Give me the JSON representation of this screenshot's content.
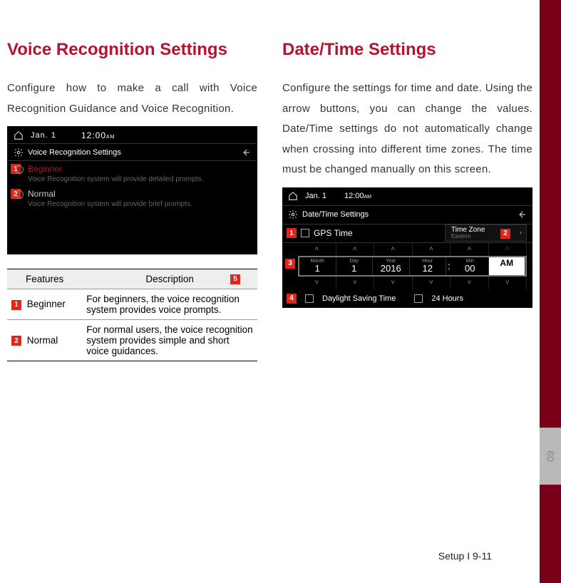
{
  "left": {
    "heading": "Voice Recognition Settings",
    "intro": "Configure how to make a call with Voice Recognition Guidance and Voice Recognition.",
    "shot": {
      "date": "Jan. 1",
      "time": "12:00",
      "ampm": "AM",
      "title": "Voice Recognition Settings",
      "opt1_num": "1",
      "opt1_label": "Beginner",
      "opt1_sub": "Voice Recognition system will provide detailed prompts.",
      "opt2_num": "2",
      "opt2_label": "Normal",
      "opt2_sub": "Voice Recognition system will provide brief prompts."
    },
    "table": {
      "h1": "Features",
      "h2": "Description",
      "h2_tag": "5",
      "r1_tag": "1",
      "r1_feat": "Beginner",
      "r1_desc": "For beginners, the voice recognition system provides voice prompts.",
      "r2_tag": "2",
      "r2_feat": "Normal",
      "r2_desc": "For normal users, the voice recognition system provides simple and short voice guidances."
    }
  },
  "right": {
    "heading": "Date/Time Settings",
    "intro": "Configure the settings for time and date. Using the arrow buttons, you can change the values. Date/Time settings do not automatically change when crossing into different time zones. The time must be changed manually on this screen.",
    "shot": {
      "date": "Jan. 1",
      "time": "12:00",
      "ampm": "AM",
      "title": "Date/Time Settings",
      "tag1": "1",
      "gps": "GPS Time",
      "tz_label": "Time Zone",
      "tz_value": "Eastern",
      "tag2": "2",
      "tag3": "3",
      "m_k": "Month",
      "m_v": "1",
      "d_k": "Day",
      "d_v": "1",
      "y_k": "Year",
      "y_v": "2016",
      "h_k": "Hour",
      "h_v": "12",
      "n_k": "Min",
      "n_v": "00",
      "ap_v": "AM",
      "tag4": "4",
      "dst": "Daylight Saving Time",
      "h24": "24 Hours"
    }
  },
  "sidebar": {
    "chapter": "09"
  },
  "footer": "Setup I 9-11"
}
